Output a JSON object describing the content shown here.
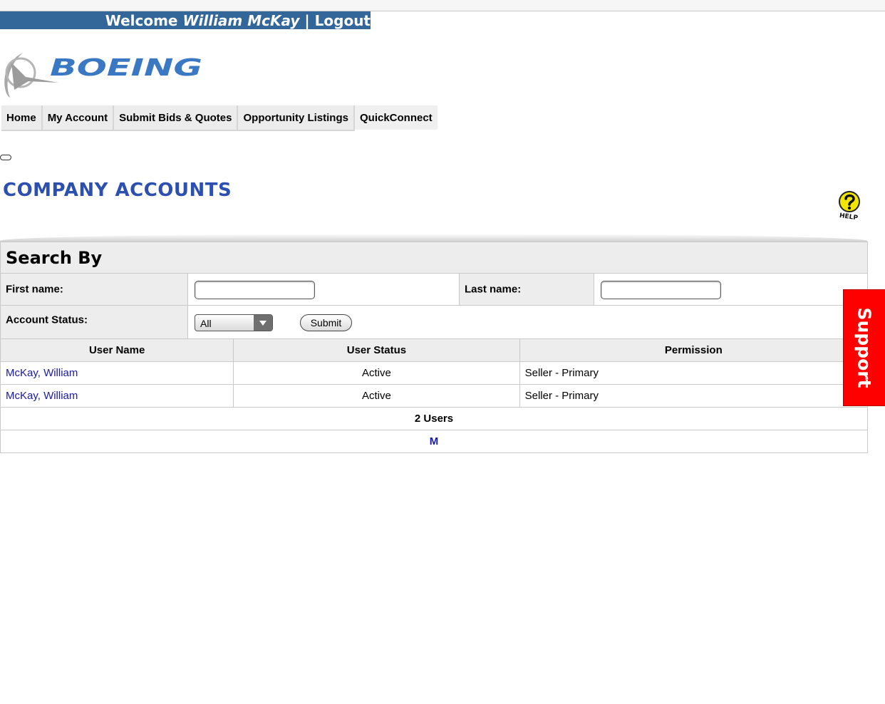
{
  "header": {
    "welcome_prefix": "Welcome ",
    "user_name": "William McKay",
    "separator": " | ",
    "logout_label": "Logout"
  },
  "logo": {
    "text": "BOEING"
  },
  "nav": {
    "items": [
      "Home",
      "My Account",
      "Submit Bids & Quotes",
      "Opportunity Listings",
      "QuickConnect"
    ]
  },
  "page": {
    "title": "COMPANY ACCOUNTS",
    "help_label": "HELP"
  },
  "search": {
    "title": "Search By",
    "first_name_label": "First name:",
    "first_name_value": "",
    "last_name_label": "Last name:",
    "last_name_value": "",
    "status_label": "Account Status:",
    "status_value": "All",
    "submit_label": "Submit"
  },
  "table": {
    "headers": [
      "User Name",
      "User Status",
      "Permission"
    ],
    "rows": [
      {
        "name": "McKay, William",
        "status": "Active",
        "permission": "Seller - Primary"
      },
      {
        "name": "McKay, William",
        "status": "Active",
        "permission": "Seller - Primary"
      }
    ],
    "count_label": "2 Users",
    "letter_link": "M"
  },
  "support": {
    "label": "Support",
    "color": "#ff0000"
  },
  "colors": {
    "header_bar": "#336699",
    "title": "#2d50b0",
    "link": "#1a1aa6"
  }
}
